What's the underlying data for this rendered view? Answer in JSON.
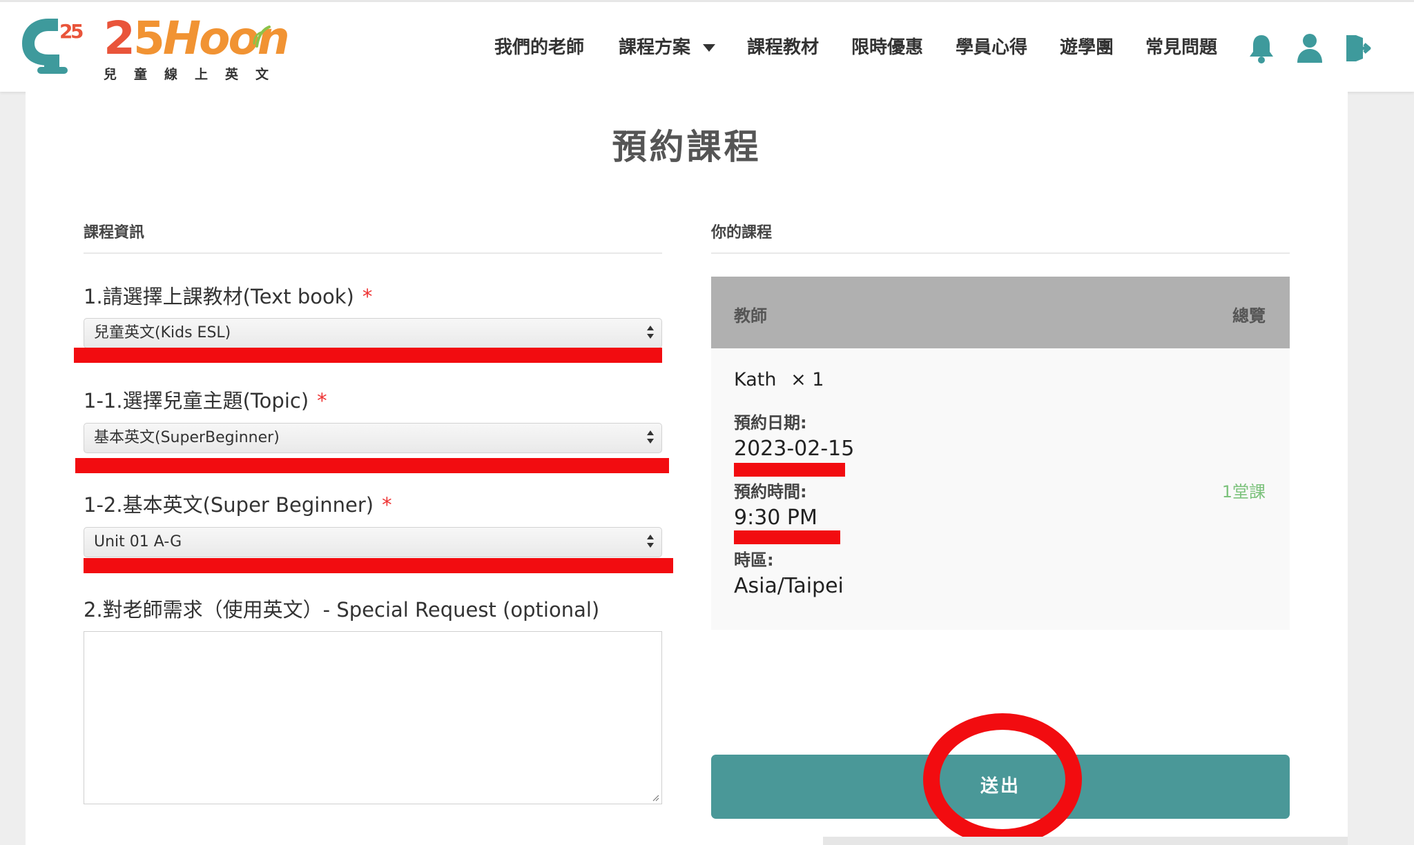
{
  "brand": {
    "wordmark_2": "2",
    "wordmark_5": "5",
    "wordmark_rest": "Hoon",
    "tagline": "兒童線上英文",
    "accent_color": "#4a9898",
    "logo_icon": "monitor-25-icon"
  },
  "nav": {
    "items": [
      "我們的老師",
      "課程方案",
      "課程教材",
      "限時優惠",
      "學員心得",
      "遊學團",
      "常見問題"
    ],
    "icons": [
      "bell-icon",
      "user-icon",
      "logout-icon"
    ]
  },
  "page": {
    "title": "預約課程"
  },
  "left": {
    "section_title": "課程資訊",
    "textbook_label": "1.請選擇上課教材(Text book)",
    "textbook_value": "兒童英文(Kids ESL)",
    "topic_label": "1-1.選擇兒童主題(Topic)",
    "topic_value": "基本英文(SuperBeginner)",
    "unit_label": "1-2.基本英文(Super Beginner)",
    "unit_value": "Unit 01 A-G",
    "required_mark": "*",
    "request_label": "2.對老師需求（使用英文）- Special Request (optional)",
    "request_value": ""
  },
  "right": {
    "section_title": "你的課程",
    "col_teacher": "教師",
    "col_overview": "總覽",
    "teacher_name": "Kath",
    "quantity": "× 1",
    "date_label": "預約日期:",
    "date_value": "2023-02-15",
    "time_label": "預約時間:",
    "time_value": "9:30 PM",
    "tz_label": "時區:",
    "tz_value": "Asia/Taipei",
    "lesson_count": "1堂課",
    "submit_label": "送出"
  }
}
